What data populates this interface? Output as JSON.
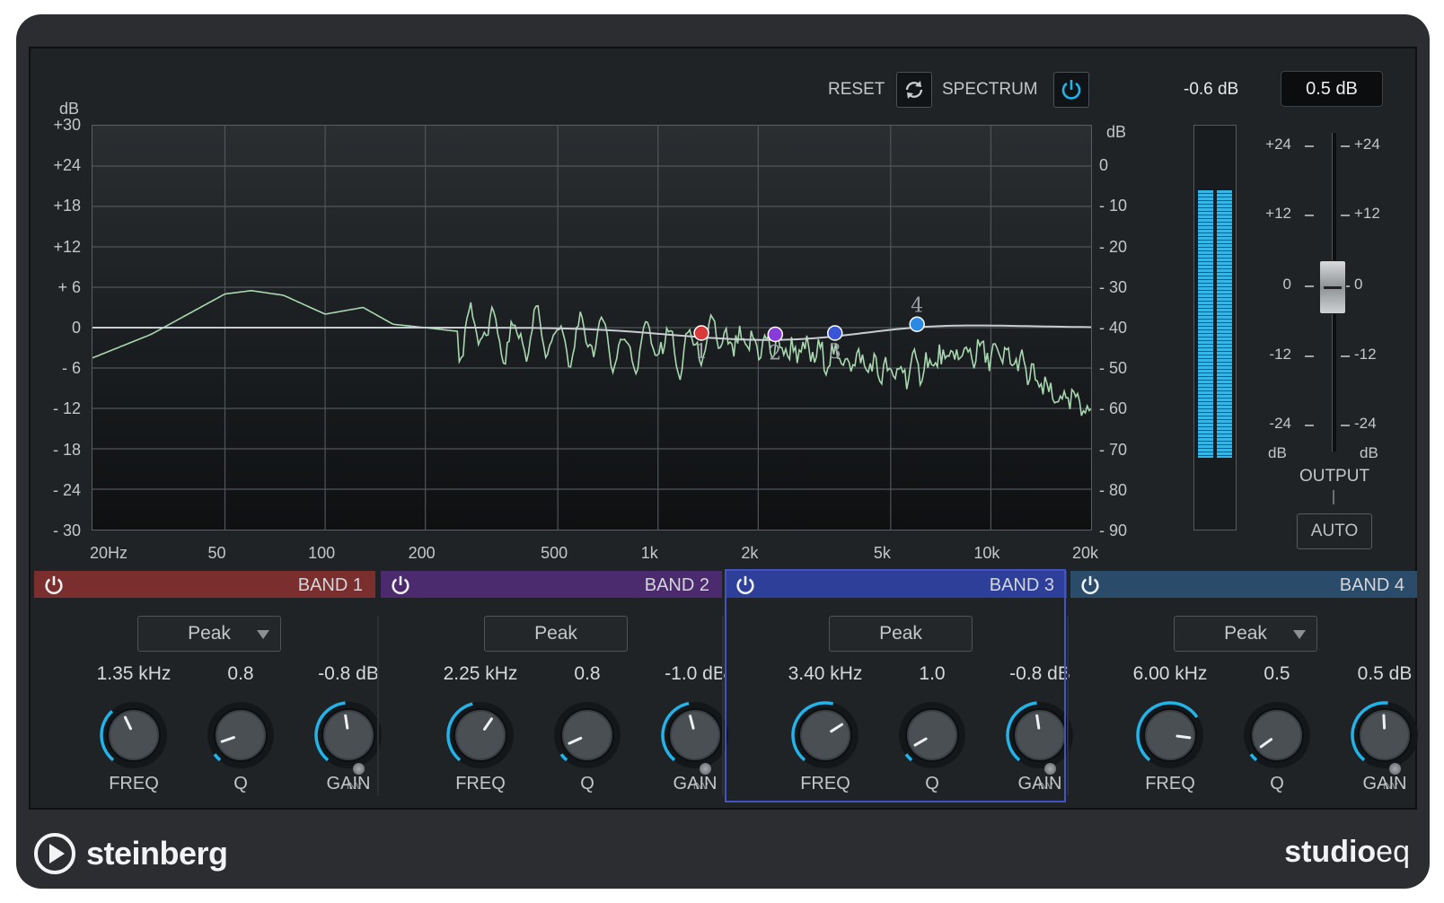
{
  "toolbar": {
    "reset_label": "RESET",
    "spectrum_label": "SPECTRUM"
  },
  "graph": {
    "left_unit": "dB",
    "right_unit": "dB",
    "left_ticks": [
      "+30",
      "+24",
      "+18",
      "+12",
      "+ 6",
      "0",
      "- 6",
      "- 12",
      "- 18",
      "- 24",
      "- 30"
    ],
    "right_ticks": [
      "0",
      "- 10",
      "- 20",
      "- 30",
      "- 40",
      "- 50",
      "- 60",
      "- 70",
      "- 80",
      "- 90"
    ],
    "freq_ticks": [
      "20Hz",
      "50",
      "100",
      "200",
      "500",
      "1k",
      "2k",
      "5k",
      "10k",
      "20k"
    ],
    "node_labels": [
      "1",
      "2",
      "3",
      "4"
    ],
    "node_colors": [
      "#d83a3a",
      "#8a3ad8",
      "#3a54d8",
      "#2a8ae6"
    ],
    "curve_color": "#c8cdd1",
    "spectrum_color": "#a9d8b0"
  },
  "meter": {
    "peak_readout": "-0.6 dB",
    "level_fraction": 0.66
  },
  "output": {
    "value": "0.5 dB",
    "label": "OUTPUT",
    "auto_label": "AUTO",
    "scale_left": [
      "+24",
      "+12",
      "0",
      "-12",
      "-24"
    ],
    "scale_right": [
      "+24",
      "+12",
      "0",
      "-12",
      "-24"
    ],
    "unit_left": "dB",
    "unit_right": "dB"
  },
  "bands": [
    {
      "title": "BAND 1",
      "color": "#7a2e2e",
      "filter": "Peak",
      "has_arrow": true,
      "freq": "1.35 kHz",
      "q": "0.8",
      "gain": "-0.8 dB",
      "freq_label": "FREQ",
      "q_label": "Q",
      "gain_label": "GAIN",
      "inv_label": "INV"
    },
    {
      "title": "BAND 2",
      "color": "#4b2a6e",
      "filter": "Peak",
      "has_arrow": false,
      "freq": "2.25 kHz",
      "q": "0.8",
      "gain": "-1.0 dB",
      "freq_label": "FREQ",
      "q_label": "Q",
      "gain_label": "GAIN",
      "inv_label": "INV"
    },
    {
      "title": "BAND 3",
      "color": "#2e3f9a",
      "filter": "Peak",
      "has_arrow": false,
      "freq": "3.40 kHz",
      "q": "1.0",
      "gain": "-0.8 dB",
      "freq_label": "FREQ",
      "q_label": "Q",
      "gain_label": "GAIN",
      "inv_label": "INV"
    },
    {
      "title": "BAND 4",
      "color": "#2b4b6b",
      "filter": "Peak",
      "has_arrow": true,
      "freq": "6.00 kHz",
      "q": "0.5",
      "gain": "0.5 dB",
      "freq_label": "FREQ",
      "q_label": "Q",
      "gain_label": "GAIN",
      "inv_label": "INV"
    }
  ],
  "branding": {
    "company": "steinberg",
    "product_bold": "studio",
    "product_light": "eq"
  },
  "accent": "#22b4e8"
}
